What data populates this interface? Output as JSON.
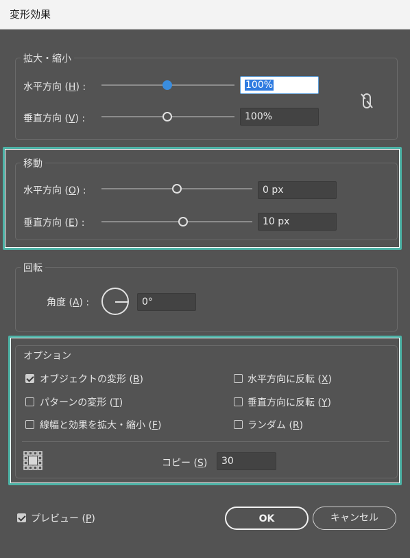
{
  "window": {
    "title": "変形効果"
  },
  "scale": {
    "group_title": "拡大・縮小",
    "horizontal": {
      "label_pre": "水平方向 (",
      "key": "H",
      "label_post": ") :",
      "value": "100%"
    },
    "vertical": {
      "label_pre": "垂直方向 (",
      "key": "V",
      "label_post": ") :",
      "value": "100%"
    },
    "link_icon": "unlink-icon"
  },
  "move": {
    "group_title": "移動",
    "horizontal": {
      "label_pre": "水平方向 (",
      "key": "O",
      "label_post": ") :",
      "value": "0 px"
    },
    "vertical": {
      "label_pre": "垂直方向 (",
      "key": "E",
      "label_post": ") :",
      "value": "10 px"
    }
  },
  "rotate": {
    "group_title": "回転",
    "angle": {
      "label_pre": "角度 (",
      "key": "A",
      "label_post": ") :",
      "value": "0°"
    }
  },
  "options": {
    "group_title": "オプション",
    "checkboxes": [
      {
        "label_pre": "オブジェクトの変形 (",
        "key": "B",
        "label_post": ")",
        "checked": true
      },
      {
        "label_pre": "パターンの変形 (",
        "key": "T",
        "label_post": ")",
        "checked": false
      },
      {
        "label_pre": "線幅と効果を拡大・縮小 (",
        "key": "F",
        "label_post": ")",
        "checked": false
      },
      {
        "label_pre": "水平方向に反転 (",
        "key": "X",
        "label_post": ")",
        "checked": false
      },
      {
        "label_pre": "垂直方向に反転 (",
        "key": "Y",
        "label_post": ")",
        "checked": false
      },
      {
        "label_pre": "ランダム (",
        "key": "R",
        "label_post": ")",
        "checked": false
      }
    ],
    "copies": {
      "label_pre": "コピー (",
      "key": "S",
      "label_post": ")",
      "value": "30"
    },
    "reference_point_icon": "reference-point-grid-icon"
  },
  "footer": {
    "preview": {
      "label_pre": "プレビュー (",
      "key": "P",
      "label_post": ")",
      "checked": true
    },
    "ok_label": "OK",
    "cancel_label": "キャンセル"
  },
  "colors": {
    "accent_highlight": "#4db3a7",
    "slider_active": "#3a8dde",
    "background": "#535353"
  }
}
